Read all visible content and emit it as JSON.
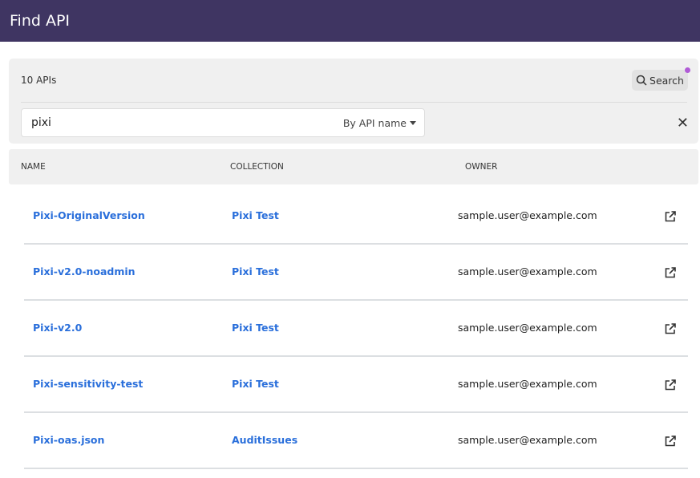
{
  "header": {
    "title": "Find API"
  },
  "filter": {
    "count": "10 APIs",
    "search_button": "Search",
    "search_value": "pixi",
    "search_mode": "By API name",
    "clear_icon": "close-icon",
    "indicator_color": "#b05bd6"
  },
  "table": {
    "columns": [
      "NAME",
      "COLLECTION",
      "OWNER"
    ],
    "rows": [
      {
        "name": "Pixi-OriginalVersion",
        "collection": "Pixi Test",
        "owner": "sample.user@example.com"
      },
      {
        "name": "Pixi-v2.0-noadmin",
        "collection": "Pixi Test",
        "owner": "sample.user@example.com"
      },
      {
        "name": "Pixi-v2.0",
        "collection": "Pixi Test",
        "owner": "sample.user@example.com"
      },
      {
        "name": "Pixi-sensitivity-test",
        "collection": "Pixi Test",
        "owner": "sample.user@example.com"
      },
      {
        "name": "Pixi-oas.json",
        "collection": "AuditIssues",
        "owner": "sample.user@example.com"
      }
    ]
  }
}
